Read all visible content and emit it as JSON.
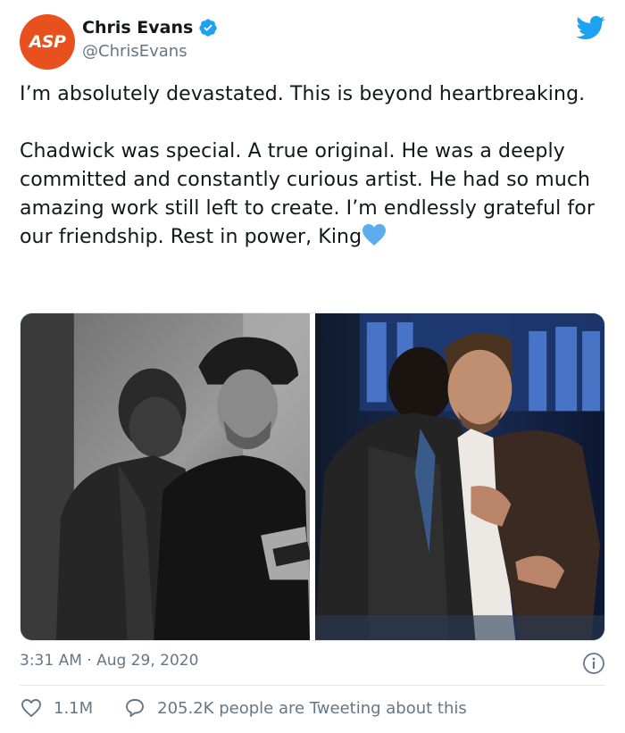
{
  "author": {
    "avatar_text": "ASP",
    "display_name": "Chris Evans",
    "handle": "@ChrisEvans",
    "verified": true
  },
  "tweet": {
    "text": "I’m absolutely devastated. This is beyond heartbreaking.\n\nChadwick was special. A true original. He was a deeply committed and constantly curious artist. He had so much amazing work still left to create. I’m endlessly grateful for our friendship. Rest in power, King",
    "emoji": "blue-heart-icon"
  },
  "meta": {
    "timestamp": "3:31 AM · Aug 29, 2020"
  },
  "actions": {
    "likes": "1.1M",
    "conversation": "205.2K people are Tweeting about this"
  },
  "colors": {
    "twitter_blue": "#1da1f2",
    "avatar_bg": "#e8501e",
    "secondary_text": "#657786"
  }
}
